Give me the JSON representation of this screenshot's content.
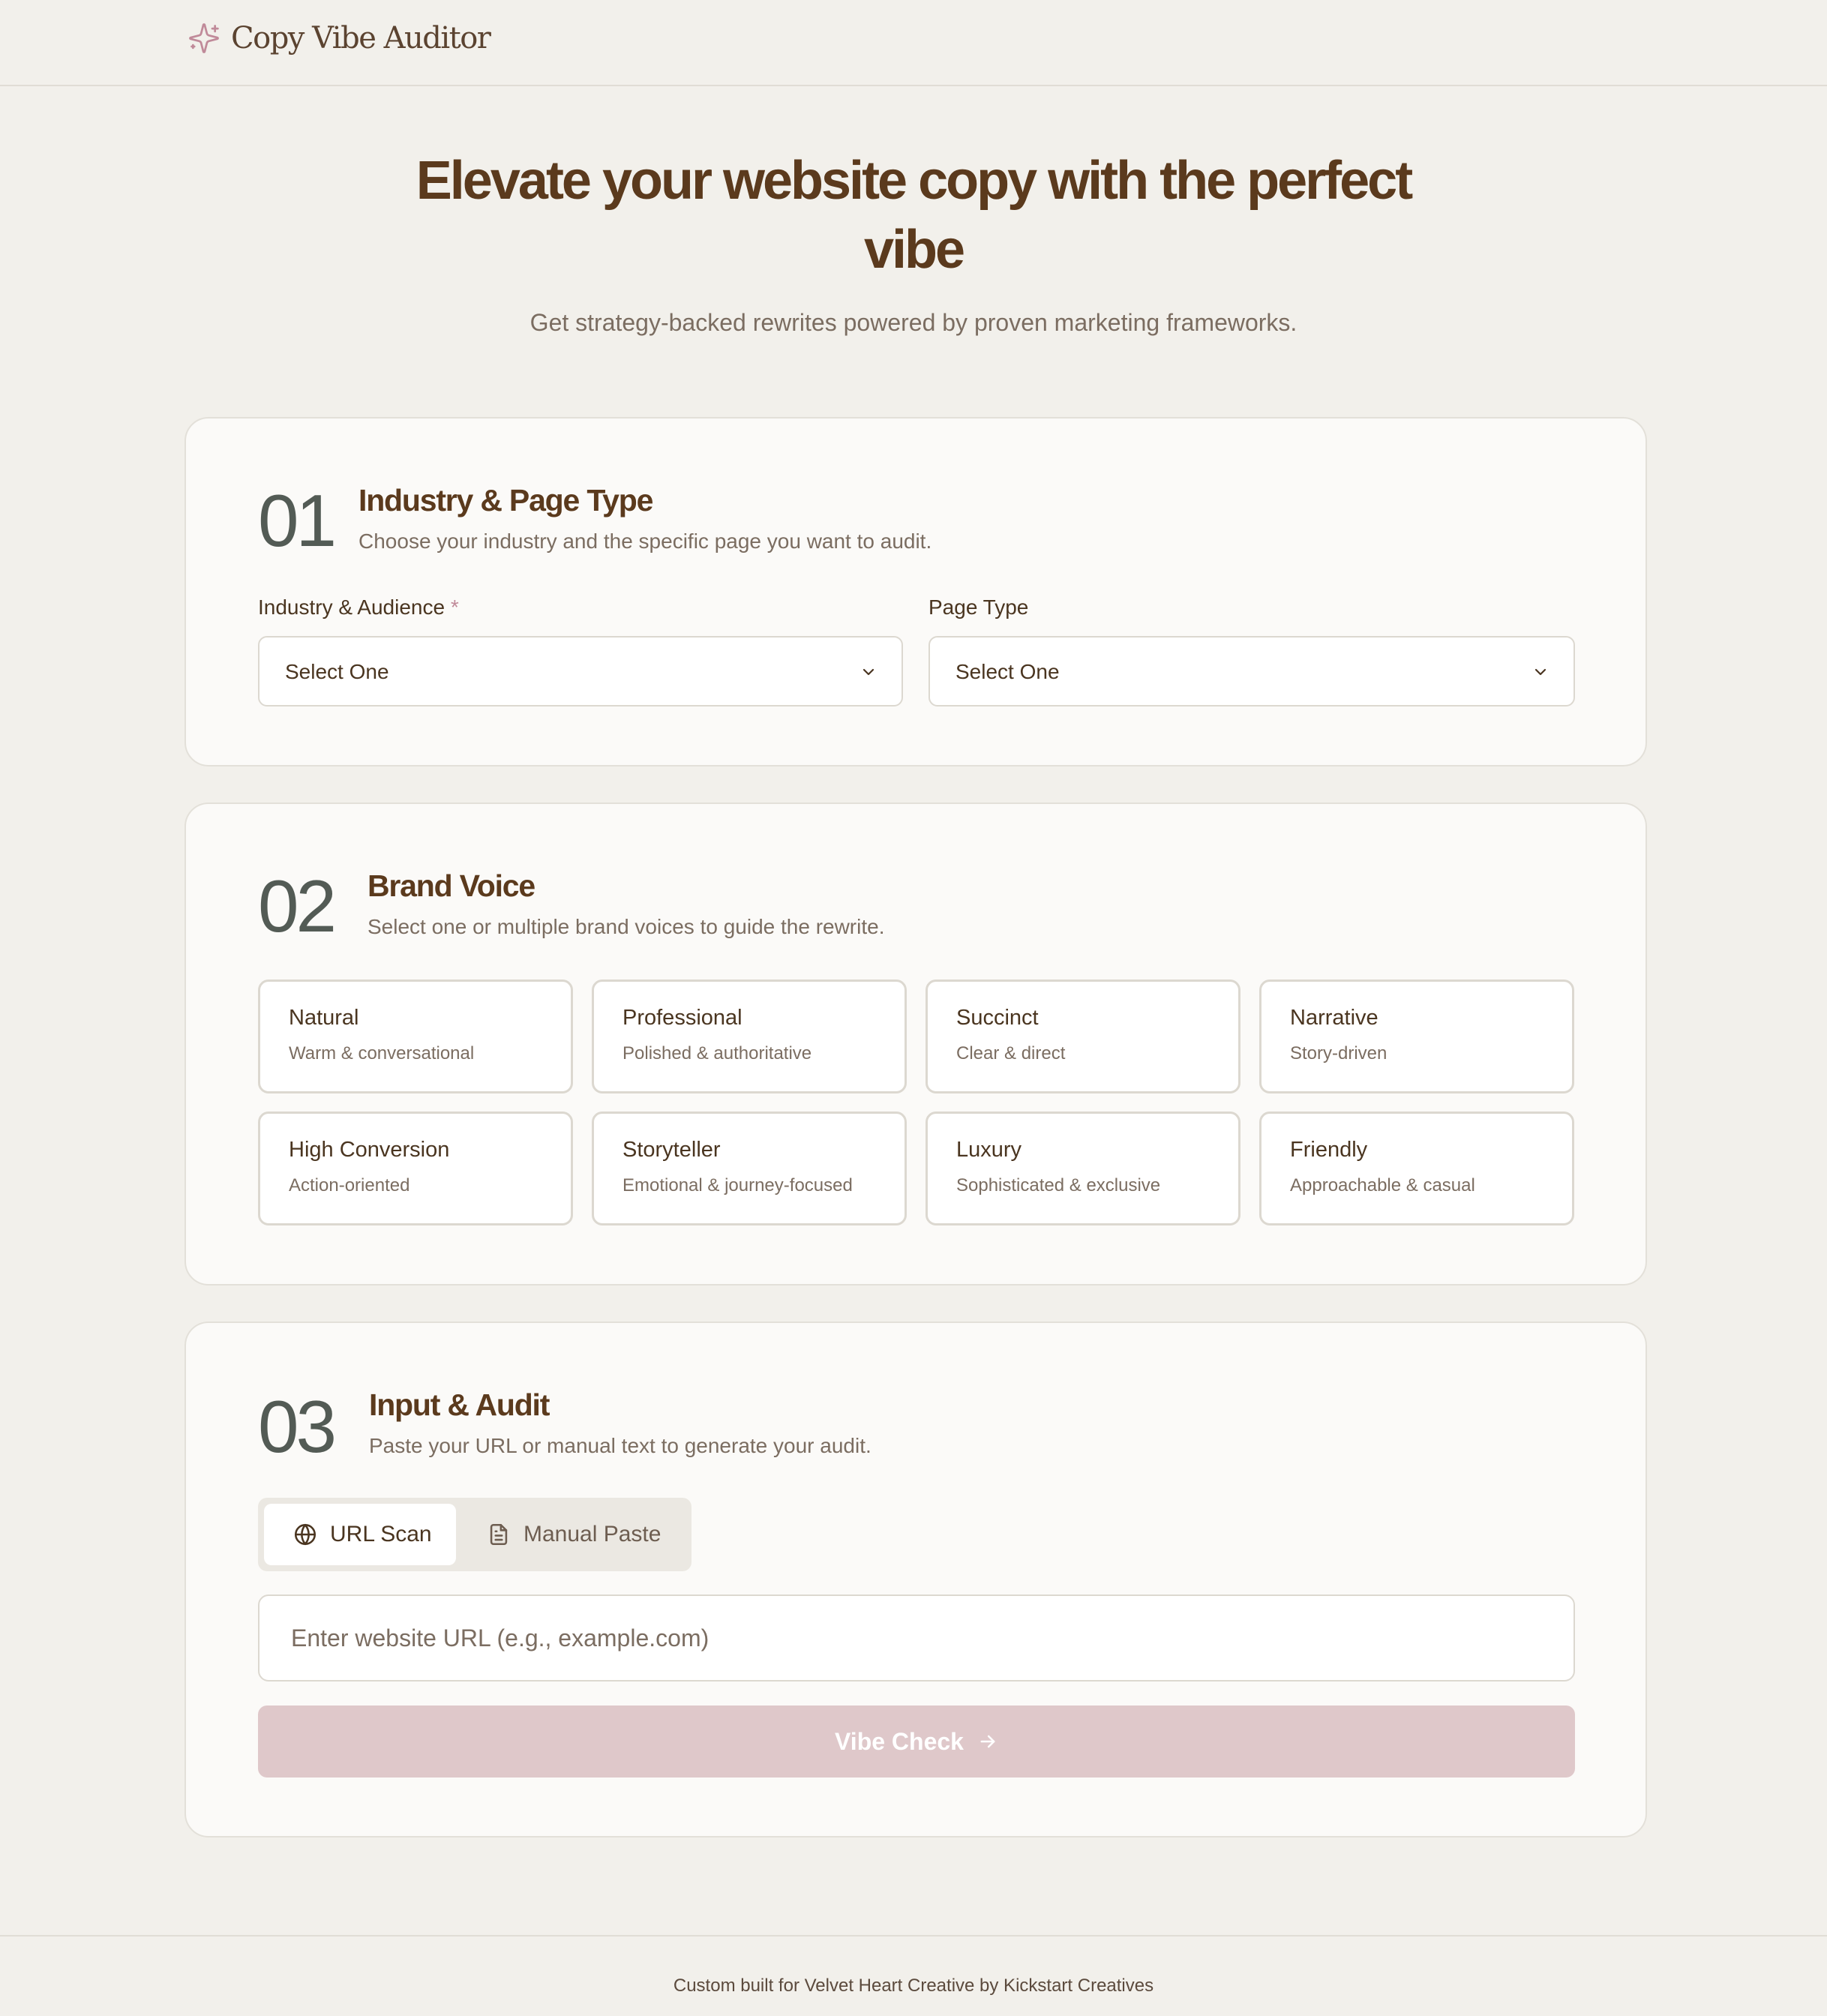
{
  "header": {
    "brand_name": "Copy Vibe Auditor",
    "brand_icon": "sparkle-icon"
  },
  "hero": {
    "title_line1": "Elevate your website copy with the perfect",
    "title_line2": "vibe",
    "subtitle": "Get strategy-backed rewrites powered by proven marketing frameworks."
  },
  "step1": {
    "number": "01",
    "title": "Industry & Page Type",
    "description": "Choose your industry and the specific page you want to audit.",
    "industry_label": "Industry & Audience",
    "required_mark": "*",
    "industry_value": "Select One",
    "page_type_label": "Page Type",
    "page_type_value": "Select One"
  },
  "step2": {
    "number": "02",
    "title": "Brand Voice",
    "description": "Select one or multiple brand voices to guide the rewrite.",
    "voices": [
      {
        "title": "Natural",
        "subtitle": "Warm & conversational"
      },
      {
        "title": "Professional",
        "subtitle": "Polished & authoritative"
      },
      {
        "title": "Succinct",
        "subtitle": "Clear & direct"
      },
      {
        "title": "Narrative",
        "subtitle": "Story-driven"
      },
      {
        "title": "High Conversion",
        "subtitle": "Action-oriented"
      },
      {
        "title": "Storyteller",
        "subtitle": "Emotional & journey-focused"
      },
      {
        "title": "Luxury",
        "subtitle": "Sophisticated & exclusive"
      },
      {
        "title": "Friendly",
        "subtitle": "Approachable & casual"
      }
    ]
  },
  "step3": {
    "number": "03",
    "title": "Input & Audit",
    "description": "Paste your URL or manual text to generate your audit.",
    "tabs": [
      {
        "label": "URL Scan",
        "icon": "globe-icon",
        "active": true
      },
      {
        "label": "Manual Paste",
        "icon": "document-icon",
        "active": false
      }
    ],
    "url_placeholder": "Enter website URL (e.g., example.com)",
    "url_value": "",
    "cta_label": "Vibe Check",
    "cta_icon": "arrow-right-icon"
  },
  "footer": {
    "text": "Custom built for Velvet Heart Creative by Kickstart Creatives"
  },
  "colors": {
    "background": "#f2f0eb",
    "card": "#fbfaf8",
    "heading": "#5b3a1d",
    "step_number": "#535b55",
    "accent_rose": "#c08a99",
    "cta_disabled": "#dfc8ca"
  }
}
